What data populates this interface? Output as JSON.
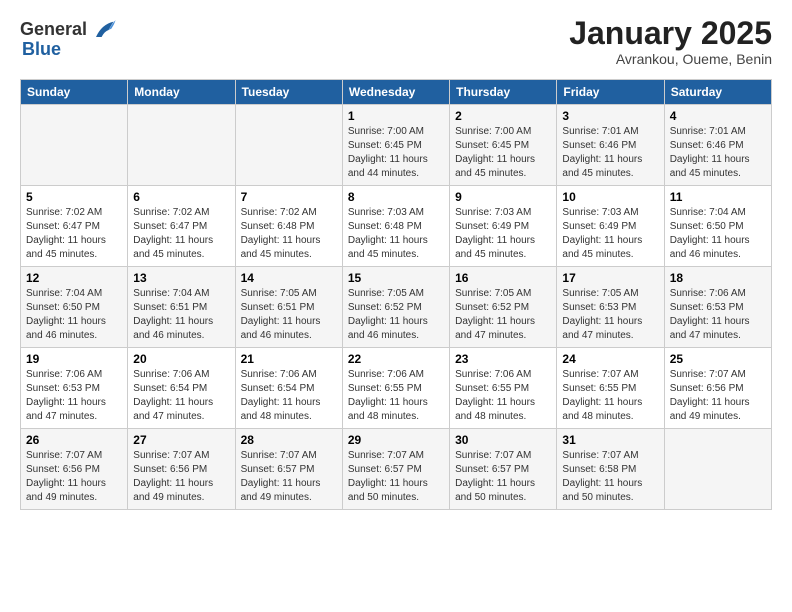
{
  "header": {
    "logo_general": "General",
    "logo_blue": "Blue",
    "month_title": "January 2025",
    "location": "Avrankou, Oueme, Benin"
  },
  "weekdays": [
    "Sunday",
    "Monday",
    "Tuesday",
    "Wednesday",
    "Thursday",
    "Friday",
    "Saturday"
  ],
  "weeks": [
    [
      {
        "day": "",
        "info": ""
      },
      {
        "day": "",
        "info": ""
      },
      {
        "day": "",
        "info": ""
      },
      {
        "day": "1",
        "info": "Sunrise: 7:00 AM\nSunset: 6:45 PM\nDaylight: 11 hours\nand 44 minutes."
      },
      {
        "day": "2",
        "info": "Sunrise: 7:00 AM\nSunset: 6:45 PM\nDaylight: 11 hours\nand 45 minutes."
      },
      {
        "day": "3",
        "info": "Sunrise: 7:01 AM\nSunset: 6:46 PM\nDaylight: 11 hours\nand 45 minutes."
      },
      {
        "day": "4",
        "info": "Sunrise: 7:01 AM\nSunset: 6:46 PM\nDaylight: 11 hours\nand 45 minutes."
      }
    ],
    [
      {
        "day": "5",
        "info": "Sunrise: 7:02 AM\nSunset: 6:47 PM\nDaylight: 11 hours\nand 45 minutes."
      },
      {
        "day": "6",
        "info": "Sunrise: 7:02 AM\nSunset: 6:47 PM\nDaylight: 11 hours\nand 45 minutes."
      },
      {
        "day": "7",
        "info": "Sunrise: 7:02 AM\nSunset: 6:48 PM\nDaylight: 11 hours\nand 45 minutes."
      },
      {
        "day": "8",
        "info": "Sunrise: 7:03 AM\nSunset: 6:48 PM\nDaylight: 11 hours\nand 45 minutes."
      },
      {
        "day": "9",
        "info": "Sunrise: 7:03 AM\nSunset: 6:49 PM\nDaylight: 11 hours\nand 45 minutes."
      },
      {
        "day": "10",
        "info": "Sunrise: 7:03 AM\nSunset: 6:49 PM\nDaylight: 11 hours\nand 45 minutes."
      },
      {
        "day": "11",
        "info": "Sunrise: 7:04 AM\nSunset: 6:50 PM\nDaylight: 11 hours\nand 46 minutes."
      }
    ],
    [
      {
        "day": "12",
        "info": "Sunrise: 7:04 AM\nSunset: 6:50 PM\nDaylight: 11 hours\nand 46 minutes."
      },
      {
        "day": "13",
        "info": "Sunrise: 7:04 AM\nSunset: 6:51 PM\nDaylight: 11 hours\nand 46 minutes."
      },
      {
        "day": "14",
        "info": "Sunrise: 7:05 AM\nSunset: 6:51 PM\nDaylight: 11 hours\nand 46 minutes."
      },
      {
        "day": "15",
        "info": "Sunrise: 7:05 AM\nSunset: 6:52 PM\nDaylight: 11 hours\nand 46 minutes."
      },
      {
        "day": "16",
        "info": "Sunrise: 7:05 AM\nSunset: 6:52 PM\nDaylight: 11 hours\nand 47 minutes."
      },
      {
        "day": "17",
        "info": "Sunrise: 7:05 AM\nSunset: 6:53 PM\nDaylight: 11 hours\nand 47 minutes."
      },
      {
        "day": "18",
        "info": "Sunrise: 7:06 AM\nSunset: 6:53 PM\nDaylight: 11 hours\nand 47 minutes."
      }
    ],
    [
      {
        "day": "19",
        "info": "Sunrise: 7:06 AM\nSunset: 6:53 PM\nDaylight: 11 hours\nand 47 minutes."
      },
      {
        "day": "20",
        "info": "Sunrise: 7:06 AM\nSunset: 6:54 PM\nDaylight: 11 hours\nand 47 minutes."
      },
      {
        "day": "21",
        "info": "Sunrise: 7:06 AM\nSunset: 6:54 PM\nDaylight: 11 hours\nand 48 minutes."
      },
      {
        "day": "22",
        "info": "Sunrise: 7:06 AM\nSunset: 6:55 PM\nDaylight: 11 hours\nand 48 minutes."
      },
      {
        "day": "23",
        "info": "Sunrise: 7:06 AM\nSunset: 6:55 PM\nDaylight: 11 hours\nand 48 minutes."
      },
      {
        "day": "24",
        "info": "Sunrise: 7:07 AM\nSunset: 6:55 PM\nDaylight: 11 hours\nand 48 minutes."
      },
      {
        "day": "25",
        "info": "Sunrise: 7:07 AM\nSunset: 6:56 PM\nDaylight: 11 hours\nand 49 minutes."
      }
    ],
    [
      {
        "day": "26",
        "info": "Sunrise: 7:07 AM\nSunset: 6:56 PM\nDaylight: 11 hours\nand 49 minutes."
      },
      {
        "day": "27",
        "info": "Sunrise: 7:07 AM\nSunset: 6:56 PM\nDaylight: 11 hours\nand 49 minutes."
      },
      {
        "day": "28",
        "info": "Sunrise: 7:07 AM\nSunset: 6:57 PM\nDaylight: 11 hours\nand 49 minutes."
      },
      {
        "day": "29",
        "info": "Sunrise: 7:07 AM\nSunset: 6:57 PM\nDaylight: 11 hours\nand 50 minutes."
      },
      {
        "day": "30",
        "info": "Sunrise: 7:07 AM\nSunset: 6:57 PM\nDaylight: 11 hours\nand 50 minutes."
      },
      {
        "day": "31",
        "info": "Sunrise: 7:07 AM\nSunset: 6:58 PM\nDaylight: 11 hours\nand 50 minutes."
      },
      {
        "day": "",
        "info": ""
      }
    ]
  ]
}
